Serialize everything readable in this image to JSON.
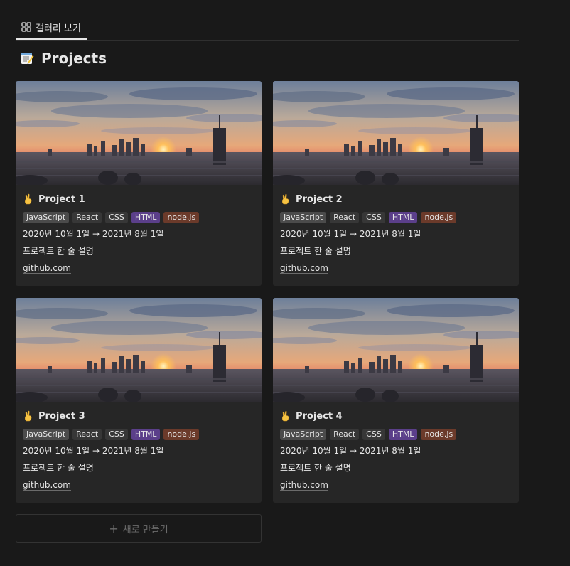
{
  "tab": {
    "label": "갤러리 보기",
    "icon": "gallery-grid-icon"
  },
  "page": {
    "title": "Projects",
    "icon": "memo-icon"
  },
  "colors": {
    "background": "#191919",
    "card": "#262626",
    "tag_default": "#4b4b4b",
    "tag_react": "#373737",
    "tag_css": "#373737",
    "tag_html": "#5b3f8a",
    "tag_node": "#6b3a2a"
  },
  "cards": [
    {
      "title": "Project 1",
      "icon": "victory-hand-icon",
      "tags": [
        "JavaScript",
        "React",
        "CSS",
        "HTML",
        "node.js"
      ],
      "date": "2020년 10월 1일 → 2021년 8월 1일",
      "description": "프로젝트 한 줄 설명",
      "link": "github.com"
    },
    {
      "title": "Project 2",
      "icon": "victory-hand-icon",
      "tags": [
        "JavaScript",
        "React",
        "CSS",
        "HTML",
        "node.js"
      ],
      "date": "2020년 10월 1일 → 2021년 8월 1일",
      "description": "프로젝트 한 줄 설명",
      "link": "github.com"
    },
    {
      "title": "Project 3",
      "icon": "victory-hand-icon",
      "tags": [
        "JavaScript",
        "React",
        "CSS",
        "HTML",
        "node.js"
      ],
      "date": "2020년 10월 1일 → 2021년 8월 1일",
      "description": "프로젝트 한 줄 설명",
      "link": "github.com"
    },
    {
      "title": "Project 4",
      "icon": "victory-hand-icon",
      "tags": [
        "JavaScript",
        "React",
        "CSS",
        "HTML",
        "node.js"
      ],
      "date": "2020년 10월 1일 → 2021년 8월 1일",
      "description": "프로젝트 한 줄 설명",
      "link": "github.com"
    }
  ],
  "new_button": {
    "label": "새로 만들기",
    "icon": "plus-icon"
  }
}
